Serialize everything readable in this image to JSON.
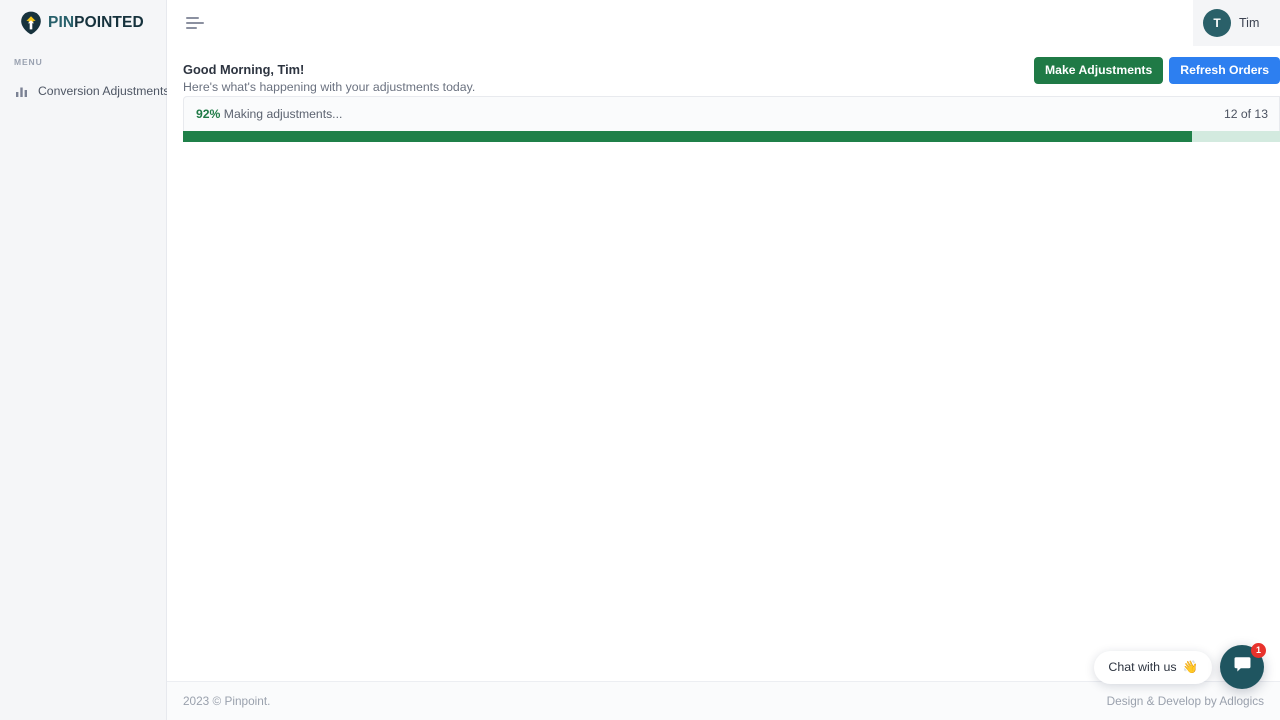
{
  "brand": {
    "logo_icon": "pin-arrow-logo-icon",
    "name_part1": "PIN",
    "name_part2": "POINTED",
    "dark_color": "#16323d",
    "accent_color": "#f5c518",
    "teal_color": "#28606b"
  },
  "sidebar": {
    "section_label": "MENU",
    "items": [
      {
        "icon": "bar-chart-icon",
        "label": "Conversion Adjustments"
      }
    ]
  },
  "header": {
    "menu_toggle_icon": "hamburger-menu-icon",
    "user": {
      "avatar_initial": "T",
      "name": "Tim"
    }
  },
  "greeting": {
    "title": "Good Morning, Tim!",
    "subtitle": "Here's what's happening with your adjustments today."
  },
  "actions": {
    "primary_label": "Make Adjustments",
    "primary_color": "#1f7a46",
    "secondary_label": "Refresh Orders",
    "secondary_color": "#2d7ff0"
  },
  "progress": {
    "percent_label": "92%",
    "status_text": "Making adjustments...",
    "count_text": "12 of 13",
    "percent_value": 92,
    "fill_color": "#1f8049",
    "track_color": "#d3eadf"
  },
  "footer": {
    "left": "2023 © Pinpoint.",
    "right": "Design & Develop by Adlogics"
  },
  "chat": {
    "pill_text": "Chat with us",
    "pill_emoji": "👋",
    "button_icon": "chat-bubble-icon",
    "badge_count": "1",
    "badge_color": "#e8322c",
    "button_color": "#1f5560"
  }
}
